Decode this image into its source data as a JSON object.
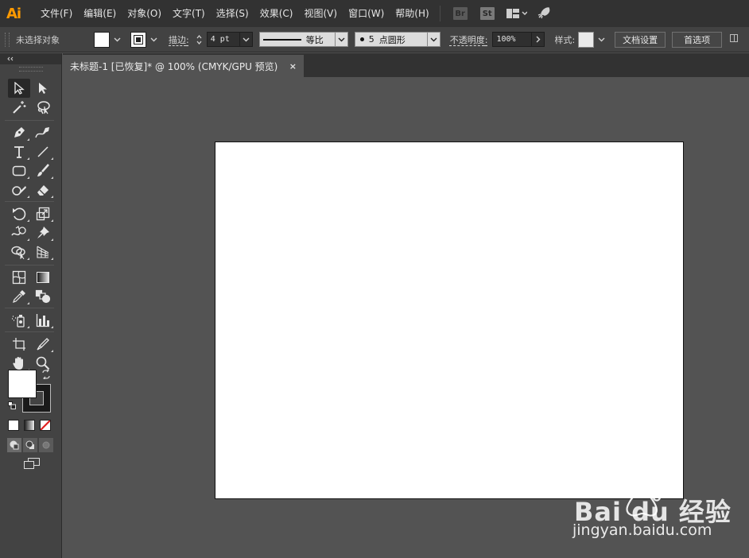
{
  "app": {
    "logo": "Ai",
    "accent": "#ff9a00"
  },
  "menubar": {
    "items": [
      "文件(F)",
      "编辑(E)",
      "对象(O)",
      "文字(T)",
      "选择(S)",
      "效果(C)",
      "视图(V)",
      "窗口(W)",
      "帮助(H)"
    ],
    "bridge_badge": "Br",
    "stock_badge": "St"
  },
  "controlbar": {
    "selection_status": "未选择对象",
    "stroke_label": "描边",
    "stroke_weight": "4 pt",
    "profile_label": "等比",
    "brush_size": "5",
    "brush_label": "点圆形",
    "opacity_label": "不透明度",
    "opacity_value": "100%",
    "style_label": "样式",
    "doc_setup_button": "文档设置",
    "preferences_button": "首选项"
  },
  "document": {
    "tab_title": "未标题-1 [已恢复]* @ 100% (CMYK/GPU 预览)",
    "close_glyph": "×",
    "artboard_color": "#ffffff",
    "canvas_color": "#535353"
  },
  "tools": [
    "selection-tool",
    "direct-selection-tool",
    "magic-wand-tool",
    "lasso-tool",
    "pen-tool",
    "curvature-tool",
    "type-tool",
    "line-segment-tool",
    "rectangle-tool",
    "paintbrush-tool",
    "shaper-tool",
    "eraser-tool",
    "rotate-tool",
    "scale-tool",
    "warp-tool",
    "puppet-warp-tool",
    "shape-builder-tool",
    "perspective-grid-tool",
    "mesh-tool",
    "gradient-tool",
    "eyedropper-tool",
    "blend-tool",
    "symbol-sprayer-tool",
    "column-graph-tool",
    "artboard-tool",
    "slice-tool",
    "hand-tool",
    "zoom-tool"
  ],
  "watermark": {
    "main": "Bai du 经验",
    "sub": "jingyan.baidu.com"
  }
}
